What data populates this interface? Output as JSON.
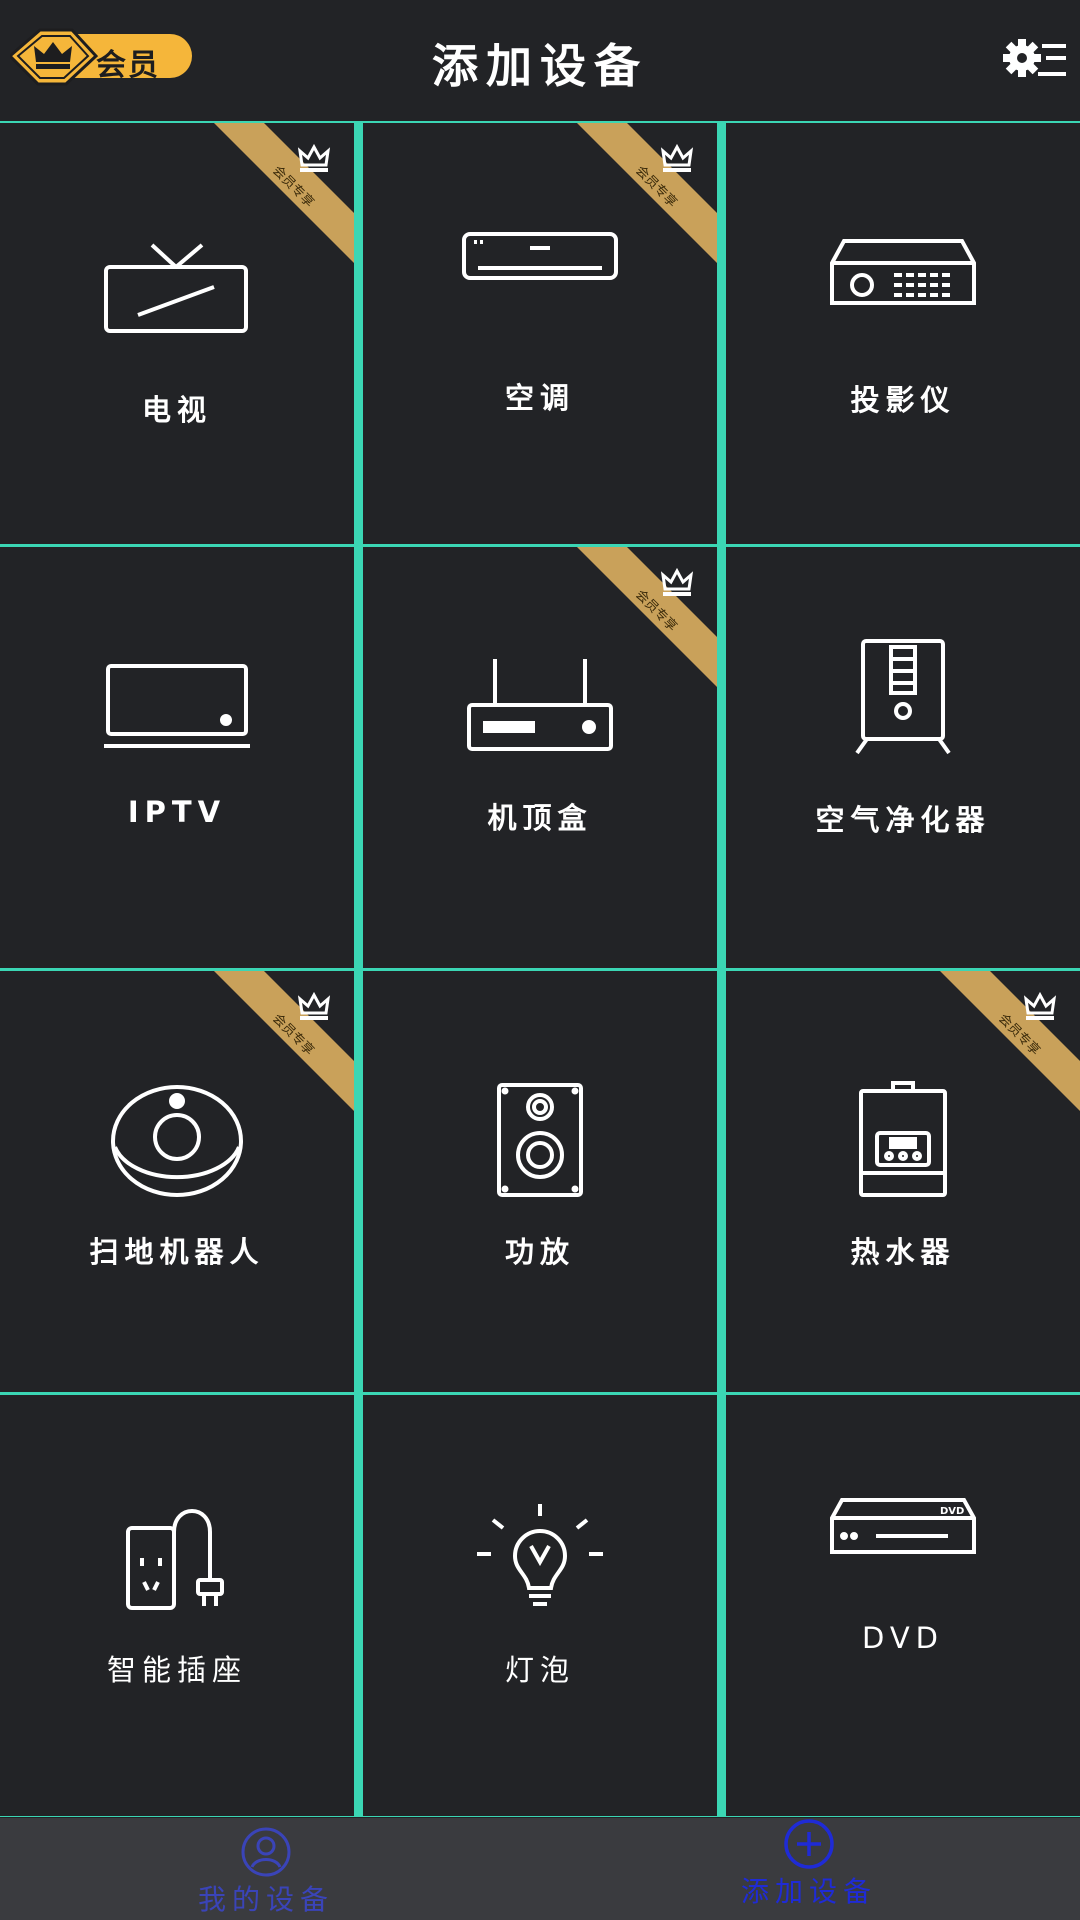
{
  "header": {
    "vip_label": "会员",
    "title": "添加设备"
  },
  "ribbon_text": "会员专享",
  "devices": [
    {
      "label": "电视",
      "icon": "tv-icon",
      "vip": true
    },
    {
      "label": "空调",
      "icon": "air-conditioner-icon",
      "vip": true
    },
    {
      "label": "投影仪",
      "icon": "projector-icon",
      "vip": false
    },
    {
      "label": "IPTV",
      "icon": "iptv-icon",
      "vip": false
    },
    {
      "label": "机顶盒",
      "icon": "set-top-box-icon",
      "vip": true
    },
    {
      "label": "空气净化器",
      "icon": "air-purifier-icon",
      "vip": false
    },
    {
      "label": "扫地机器人",
      "icon": "robot-vacuum-icon",
      "vip": true
    },
    {
      "label": "功放",
      "icon": "speaker-icon",
      "vip": false
    },
    {
      "label": "热水器",
      "icon": "water-heater-icon",
      "vip": true
    },
    {
      "label": "智能插座",
      "icon": "smart-plug-icon",
      "vip": false
    },
    {
      "label": "灯泡",
      "icon": "light-bulb-icon",
      "vip": false
    },
    {
      "label": "DVD",
      "icon": "dvd-player-icon",
      "vip": false
    }
  ],
  "dvd_badge": "DVD",
  "tabbar": {
    "my_devices": "我的设备",
    "add_device": "添加设备"
  },
  "colors": {
    "background": "#222326",
    "grid_line": "#3bd6b4",
    "vip_gold": "#f5b63a",
    "ribbon_gold": "#c9a15a",
    "tab_active": "#1f2bd6",
    "tab_inactive": "#3a44b8"
  }
}
